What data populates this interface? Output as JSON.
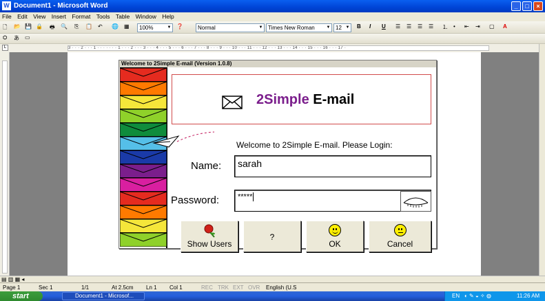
{
  "window": {
    "title": "Document1 - Microsoft Word"
  },
  "menu": [
    "File",
    "Edit",
    "View",
    "Insert",
    "Format",
    "Tools",
    "Table",
    "Window",
    "Help"
  ],
  "toolbar": {
    "zoom": "100%",
    "style": "Normal",
    "font": "Times New Roman",
    "size": "12",
    "bold": "B",
    "italic": "I",
    "underline": "U"
  },
  "ruler": {
    "marks": "3 · · · 2 · · · 1 · · · ·  · · · 1 · · · 2 · · · 3 · · · 4 · · · 5 · · · 6 · · · 7 · · · 8 · · · 9 · · · 10 · · · 11 · · · 12 · · · 13 · · · 14 · · · 15 · · · 16 · · · 17 ·"
  },
  "dialog": {
    "title": "Welcome to 2Simple E-mail (Version 1.0.8)",
    "logo_part1": "2Simple",
    "logo_part2": "E-mail",
    "welcome": "Welcome to 2Simple E-mail. Please Login:",
    "name_label": "Name:",
    "name_value": "sarah",
    "password_label": "Password:",
    "password_value": "*****",
    "buttons": {
      "show_users": "Show Users",
      "help": "?",
      "ok": "OK",
      "cancel": "Cancel"
    }
  },
  "envelope_colors": [
    "#e52b1f",
    "#ff7a00",
    "#f5e63a",
    "#8fd12a",
    "#0f8c3c",
    "#55bfe8",
    "#1a3aa8",
    "#7b1e8c",
    "#d91fa0",
    "#e52b1f",
    "#ff7a00",
    "#f5e63a",
    "#8fd12a"
  ],
  "status": {
    "page": "Page 1",
    "sec": "Sec 1",
    "pages": "1/1",
    "at": "At 2.5cm",
    "ln": "Ln 1",
    "col": "Col 1",
    "rec": "REC",
    "trk": "TRK",
    "ext": "EXT",
    "ovr": "OVR",
    "lang": "English (U.S"
  },
  "taskbar": {
    "start": "start",
    "item": "Document1 - Microsof...",
    "lang": "EN",
    "time": "11:26 AM"
  }
}
